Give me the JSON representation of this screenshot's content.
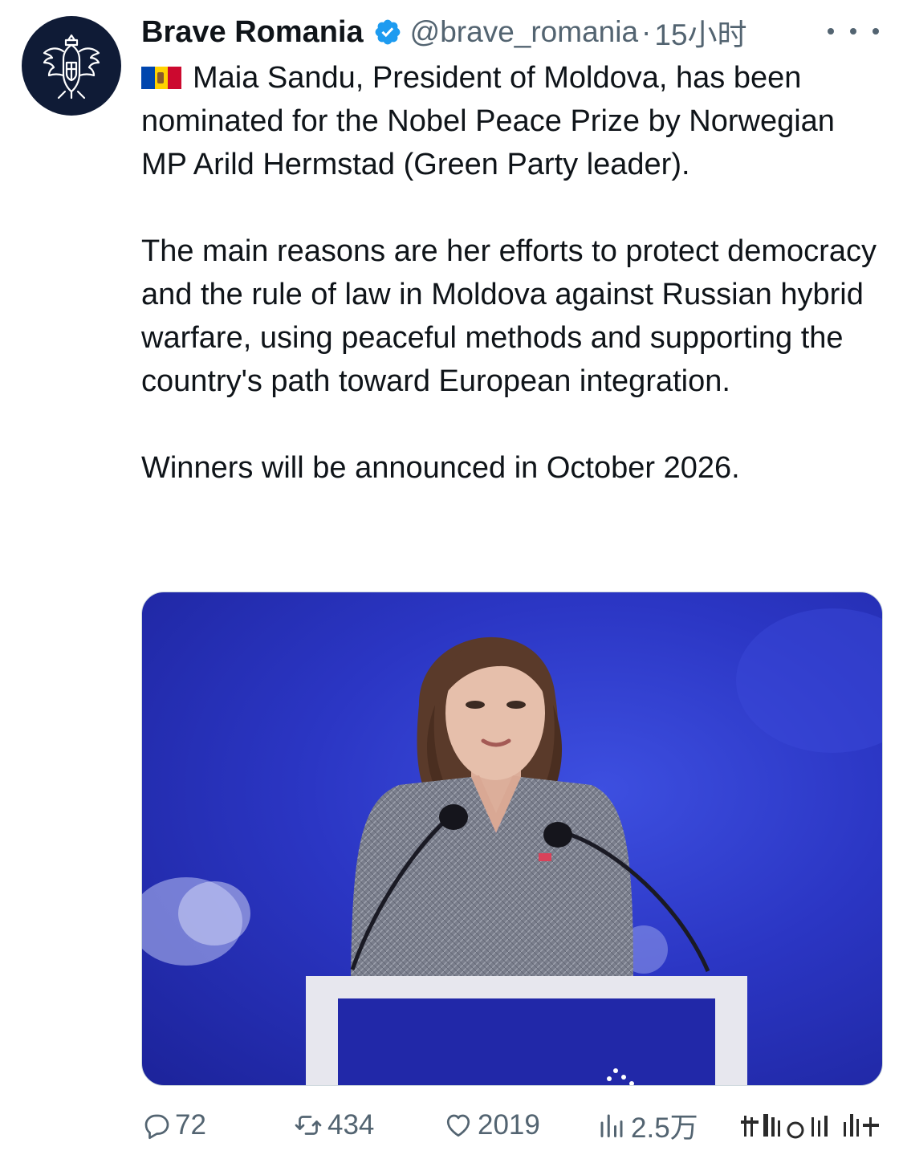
{
  "author": {
    "display_name": "Brave Romania",
    "handle": "@brave_romania",
    "separator": "·",
    "timestamp": "15小时",
    "verified_color": "#1d9bf0",
    "avatar_bg": "#0f1b36"
  },
  "tweet": {
    "flag_icon": "moldova-flag-emoji",
    "paragraphs": [
      "Maia Sandu, President of Moldova, has been nominated for the Nobel Peace Prize by Norwegian MP Arild Hermstad (Green Party leader).",
      "The main reasons are her efforts to protect democracy and the rule of law in Moldova against Russian hybrid warfare, using peaceful methods and supporting the country's path toward European integration.",
      "Winners will be announced in October 2026."
    ]
  },
  "metrics": {
    "replies": "72",
    "retweets": "434",
    "likes": "2019",
    "views": "2.5万"
  },
  "icons": {
    "more": "more-horizontal-icon",
    "reply": "reply-bubble-icon",
    "retweet": "retweet-icon",
    "like": "heart-icon",
    "views": "views-bar-chart-icon",
    "share": "share-watermark-icon"
  }
}
